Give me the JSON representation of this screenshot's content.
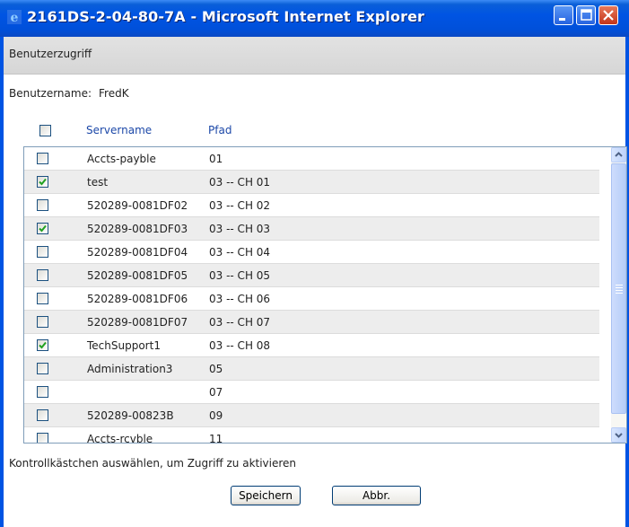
{
  "window": {
    "title": "2161DS-2-04-80-7A - Microsoft Internet Explorer"
  },
  "header": {
    "title": "Benutzerzugriff"
  },
  "user": {
    "label": "Benutzername:",
    "value": "FredK"
  },
  "table": {
    "columns": [
      "Servername",
      "Pfad"
    ],
    "rows": [
      {
        "name": "Accts-payble",
        "path": "01",
        "checked": false
      },
      {
        "name": "test",
        "path": "03 -- CH 01",
        "checked": true
      },
      {
        "name": "520289-0081DF02",
        "path": "03 -- CH 02",
        "checked": false
      },
      {
        "name": "520289-0081DF03",
        "path": "03 -- CH 03",
        "checked": true
      },
      {
        "name": "520289-0081DF04",
        "path": "03 -- CH 04",
        "checked": false
      },
      {
        "name": "520289-0081DF05",
        "path": "03 -- CH 05",
        "checked": false
      },
      {
        "name": "520289-0081DF06",
        "path": "03 -- CH 06",
        "checked": false
      },
      {
        "name": "520289-0081DF07",
        "path": "03 -- CH 07",
        "checked": false
      },
      {
        "name": "TechSupport1",
        "path": "03 -- CH 08",
        "checked": true
      },
      {
        "name": "Administration3",
        "path": "05",
        "checked": false
      },
      {
        "name": "",
        "path": "07",
        "checked": false
      },
      {
        "name": "520289-00823B",
        "path": "09",
        "checked": false
      },
      {
        "name": "Accts-rcvble",
        "path": "11",
        "checked": false
      }
    ]
  },
  "footer": {
    "note": "Kontrollkästchen auswählen, um Zugriff zu aktivieren",
    "save_label": "Speichern",
    "cancel_label": "Abbr."
  },
  "colors": {
    "titlebar": "#0054e3",
    "link_header": "#1c48a8",
    "check": "#21a121"
  },
  "icons": [
    "ie-icon",
    "minimize-icon",
    "maximize-icon",
    "close-icon",
    "scroll-up-icon",
    "scroll-down-icon",
    "checkmark-icon"
  ]
}
